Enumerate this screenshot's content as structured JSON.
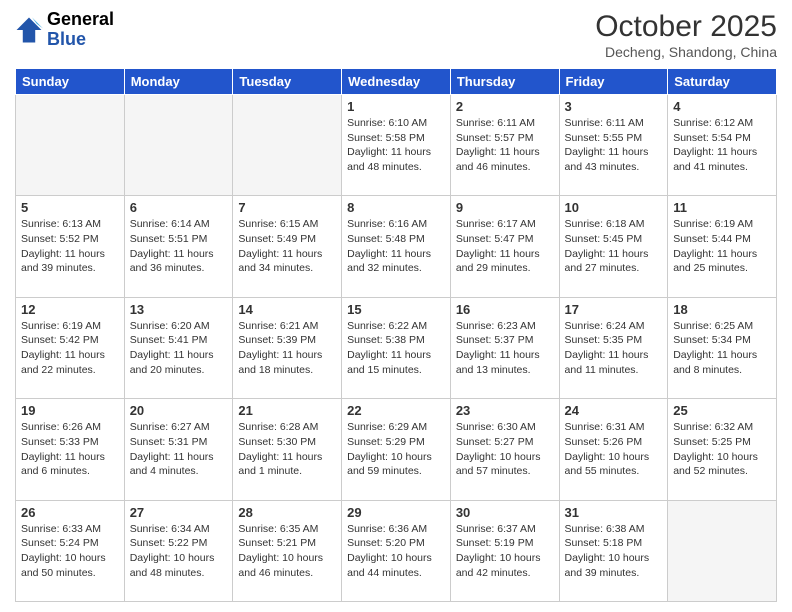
{
  "header": {
    "logo_line1": "General",
    "logo_line2": "Blue",
    "month": "October 2025",
    "location": "Decheng, Shandong, China"
  },
  "days_of_week": [
    "Sunday",
    "Monday",
    "Tuesday",
    "Wednesday",
    "Thursday",
    "Friday",
    "Saturday"
  ],
  "weeks": [
    [
      {
        "day": "",
        "info": ""
      },
      {
        "day": "",
        "info": ""
      },
      {
        "day": "",
        "info": ""
      },
      {
        "day": "1",
        "info": "Sunrise: 6:10 AM\nSunset: 5:58 PM\nDaylight: 11 hours and 48 minutes."
      },
      {
        "day": "2",
        "info": "Sunrise: 6:11 AM\nSunset: 5:57 PM\nDaylight: 11 hours and 46 minutes."
      },
      {
        "day": "3",
        "info": "Sunrise: 6:11 AM\nSunset: 5:55 PM\nDaylight: 11 hours and 43 minutes."
      },
      {
        "day": "4",
        "info": "Sunrise: 6:12 AM\nSunset: 5:54 PM\nDaylight: 11 hours and 41 minutes."
      }
    ],
    [
      {
        "day": "5",
        "info": "Sunrise: 6:13 AM\nSunset: 5:52 PM\nDaylight: 11 hours and 39 minutes."
      },
      {
        "day": "6",
        "info": "Sunrise: 6:14 AM\nSunset: 5:51 PM\nDaylight: 11 hours and 36 minutes."
      },
      {
        "day": "7",
        "info": "Sunrise: 6:15 AM\nSunset: 5:49 PM\nDaylight: 11 hours and 34 minutes."
      },
      {
        "day": "8",
        "info": "Sunrise: 6:16 AM\nSunset: 5:48 PM\nDaylight: 11 hours and 32 minutes."
      },
      {
        "day": "9",
        "info": "Sunrise: 6:17 AM\nSunset: 5:47 PM\nDaylight: 11 hours and 29 minutes."
      },
      {
        "day": "10",
        "info": "Sunrise: 6:18 AM\nSunset: 5:45 PM\nDaylight: 11 hours and 27 minutes."
      },
      {
        "day": "11",
        "info": "Sunrise: 6:19 AM\nSunset: 5:44 PM\nDaylight: 11 hours and 25 minutes."
      }
    ],
    [
      {
        "day": "12",
        "info": "Sunrise: 6:19 AM\nSunset: 5:42 PM\nDaylight: 11 hours and 22 minutes."
      },
      {
        "day": "13",
        "info": "Sunrise: 6:20 AM\nSunset: 5:41 PM\nDaylight: 11 hours and 20 minutes."
      },
      {
        "day": "14",
        "info": "Sunrise: 6:21 AM\nSunset: 5:39 PM\nDaylight: 11 hours and 18 minutes."
      },
      {
        "day": "15",
        "info": "Sunrise: 6:22 AM\nSunset: 5:38 PM\nDaylight: 11 hours and 15 minutes."
      },
      {
        "day": "16",
        "info": "Sunrise: 6:23 AM\nSunset: 5:37 PM\nDaylight: 11 hours and 13 minutes."
      },
      {
        "day": "17",
        "info": "Sunrise: 6:24 AM\nSunset: 5:35 PM\nDaylight: 11 hours and 11 minutes."
      },
      {
        "day": "18",
        "info": "Sunrise: 6:25 AM\nSunset: 5:34 PM\nDaylight: 11 hours and 8 minutes."
      }
    ],
    [
      {
        "day": "19",
        "info": "Sunrise: 6:26 AM\nSunset: 5:33 PM\nDaylight: 11 hours and 6 minutes."
      },
      {
        "day": "20",
        "info": "Sunrise: 6:27 AM\nSunset: 5:31 PM\nDaylight: 11 hours and 4 minutes."
      },
      {
        "day": "21",
        "info": "Sunrise: 6:28 AM\nSunset: 5:30 PM\nDaylight: 11 hours and 1 minute."
      },
      {
        "day": "22",
        "info": "Sunrise: 6:29 AM\nSunset: 5:29 PM\nDaylight: 10 hours and 59 minutes."
      },
      {
        "day": "23",
        "info": "Sunrise: 6:30 AM\nSunset: 5:27 PM\nDaylight: 10 hours and 57 minutes."
      },
      {
        "day": "24",
        "info": "Sunrise: 6:31 AM\nSunset: 5:26 PM\nDaylight: 10 hours and 55 minutes."
      },
      {
        "day": "25",
        "info": "Sunrise: 6:32 AM\nSunset: 5:25 PM\nDaylight: 10 hours and 52 minutes."
      }
    ],
    [
      {
        "day": "26",
        "info": "Sunrise: 6:33 AM\nSunset: 5:24 PM\nDaylight: 10 hours and 50 minutes."
      },
      {
        "day": "27",
        "info": "Sunrise: 6:34 AM\nSunset: 5:22 PM\nDaylight: 10 hours and 48 minutes."
      },
      {
        "day": "28",
        "info": "Sunrise: 6:35 AM\nSunset: 5:21 PM\nDaylight: 10 hours and 46 minutes."
      },
      {
        "day": "29",
        "info": "Sunrise: 6:36 AM\nSunset: 5:20 PM\nDaylight: 10 hours and 44 minutes."
      },
      {
        "day": "30",
        "info": "Sunrise: 6:37 AM\nSunset: 5:19 PM\nDaylight: 10 hours and 42 minutes."
      },
      {
        "day": "31",
        "info": "Sunrise: 6:38 AM\nSunset: 5:18 PM\nDaylight: 10 hours and 39 minutes."
      },
      {
        "day": "",
        "info": ""
      }
    ]
  ]
}
